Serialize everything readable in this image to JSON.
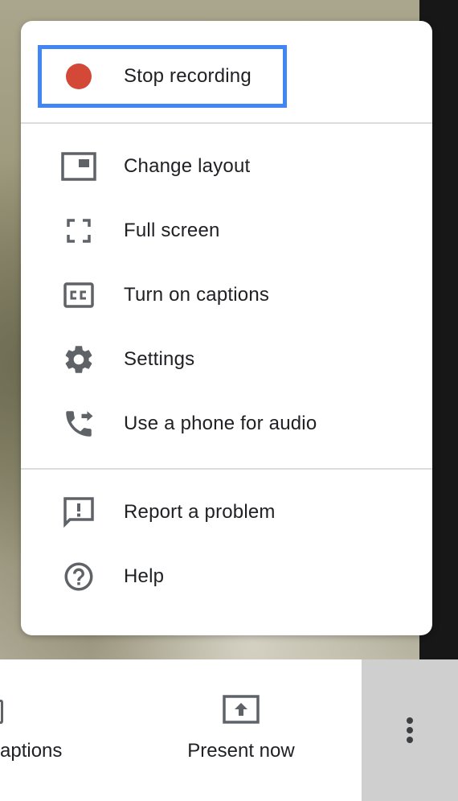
{
  "menu": {
    "items": [
      {
        "label": "Stop recording",
        "icon": "record-dot-icon"
      },
      {
        "label": "Change layout",
        "icon": "layout-icon"
      },
      {
        "label": "Full screen",
        "icon": "fullscreen-icon"
      },
      {
        "label": "Turn on captions",
        "icon": "captions-icon"
      },
      {
        "label": "Settings",
        "icon": "gear-icon"
      },
      {
        "label": "Use a phone for audio",
        "icon": "phone-audio-icon"
      },
      {
        "label": "Report a problem",
        "icon": "report-icon"
      },
      {
        "label": "Help",
        "icon": "help-icon"
      }
    ]
  },
  "bottom_bar": {
    "captions_label": "aptions",
    "present_label": "Present now",
    "more_icon": "more-vertical-icon"
  },
  "colors": {
    "record": "#d34836",
    "focus": "#4285f4",
    "icon": "#5f6368",
    "text": "#202124"
  }
}
